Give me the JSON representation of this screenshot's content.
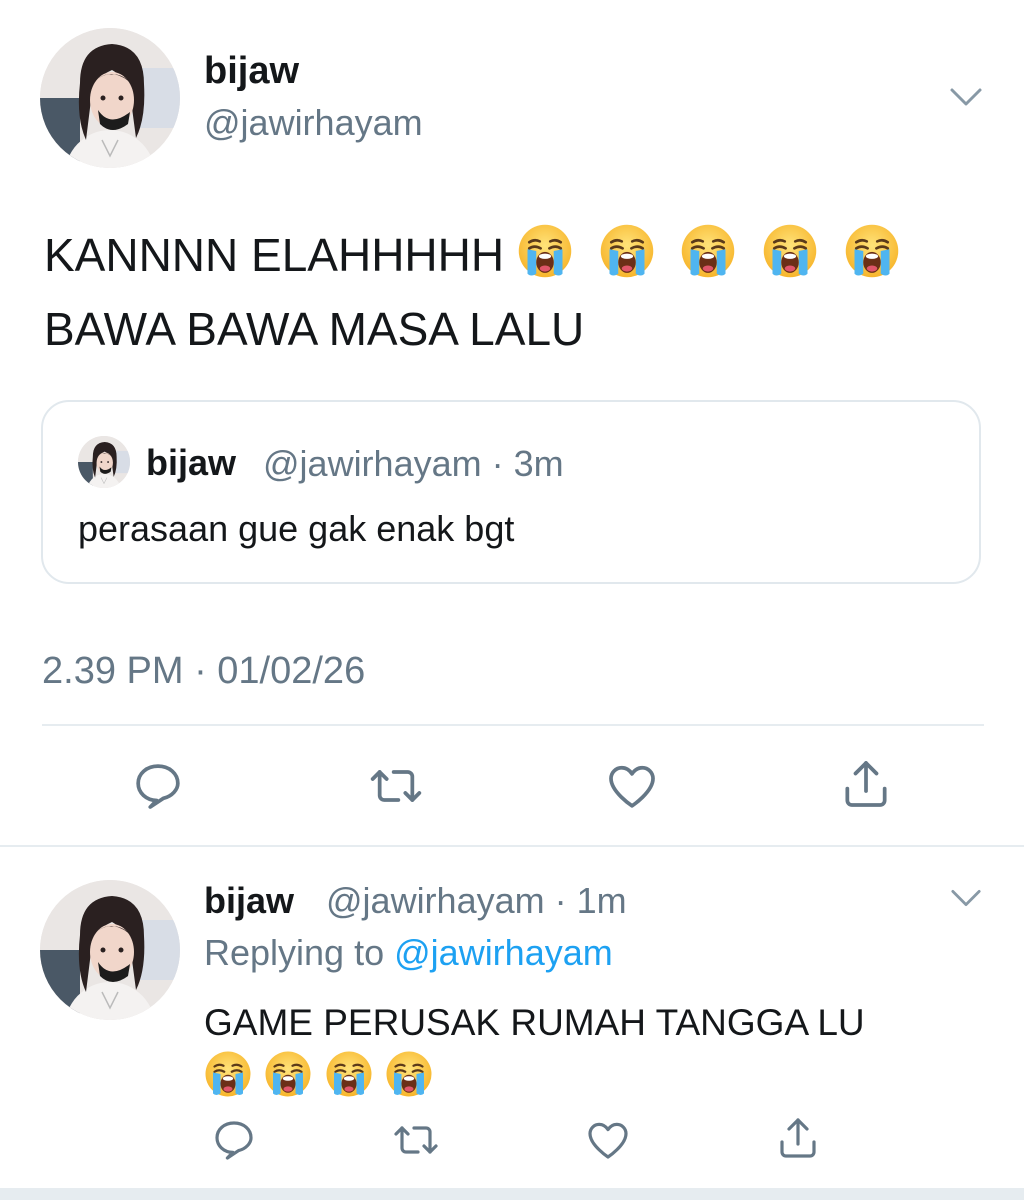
{
  "main_tweet": {
    "author_name": "bijaw",
    "author_handle": "@jawirhayam",
    "text_line_1": "KANNNN ELAHHHHH",
    "text_line_2": "BAWA BAWA MASA LALU",
    "emoji_count": 5,
    "emoji_icon": "loudly-crying-face-emoji",
    "timestamp": "2.39 PM · 01/02/26"
  },
  "quoted_tweet": {
    "author_name": "bijaw",
    "author_handle": "@jawirhayam",
    "time": "· 3m",
    "text": "perasaan gue gak enak bgt"
  },
  "reply_tweet": {
    "author_name": "bijaw",
    "author_handle": "@jawirhayam",
    "time": "· 1m",
    "replying_prefix": "Replying to",
    "replying_handle": "@jawirhayam",
    "text": "GAME PERUSAK RUMAH TANGGA LU",
    "emoji_count": 4
  },
  "icons": {
    "reply": "reply-icon",
    "retweet": "retweet-icon",
    "like": "heart-icon",
    "share": "share-icon",
    "more": "chevron-down-icon"
  },
  "colors": {
    "text_primary": "#14171a",
    "text_secondary": "#657786",
    "link": "#1da1f2",
    "border": "#e1e8ed",
    "icon": "#657786",
    "divider": "#e6ecf0"
  }
}
